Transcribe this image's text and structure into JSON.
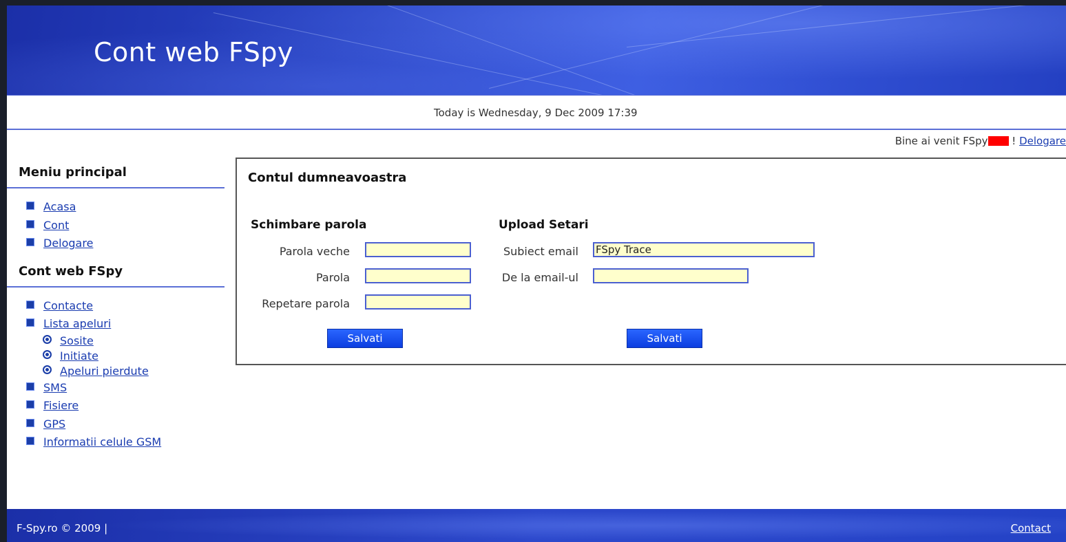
{
  "banner": {
    "title": "Cont web FSpy"
  },
  "datebar": {
    "text": "Today is Wednesday, 9 Dec 2009 17:39"
  },
  "welcome": {
    "text": "Bine ai venit FSpy",
    "sep": " ! ",
    "logout": "Delogare"
  },
  "sidebar": {
    "main_heading": "Meniu principal",
    "main_items": [
      {
        "label": "Acasa"
      },
      {
        "label": "Cont"
      },
      {
        "label": "Delogare"
      }
    ],
    "web_heading": "Cont web FSpy",
    "web_items": [
      {
        "label": "Contacte"
      },
      {
        "label": "Lista apeluri"
      },
      {
        "label": "SMS"
      },
      {
        "label": "Fisiere"
      },
      {
        "label": "GPS"
      },
      {
        "label": "Informatii celule GSM"
      }
    ],
    "call_subitems": [
      {
        "label": "Sosite"
      },
      {
        "label": "Initiate"
      },
      {
        "label": "Apeluri pierdute"
      }
    ]
  },
  "panel": {
    "title": "Contul dumneavoastra",
    "password": {
      "title": "Schimbare parola",
      "old_label": "Parola veche",
      "new_label": "Parola",
      "repeat_label": "Repetare parola",
      "old_value": "",
      "new_value": "",
      "repeat_value": "",
      "save_label": "Salvati"
    },
    "upload": {
      "title": "Upload Setari",
      "subject_label": "Subiect email",
      "subject_value": "FSpy Trace",
      "from_label": "De la email-ul",
      "from_value": "",
      "save_label": "Salvati"
    }
  },
  "footer": {
    "copyright": "F-Spy.ro © 2009  |",
    "contact": "Contact"
  },
  "colors": {
    "brand_blue": "#2b47c8",
    "input_bg": "#ffffcc",
    "link": "#1a3cb0",
    "redacted": "#ff0000"
  }
}
